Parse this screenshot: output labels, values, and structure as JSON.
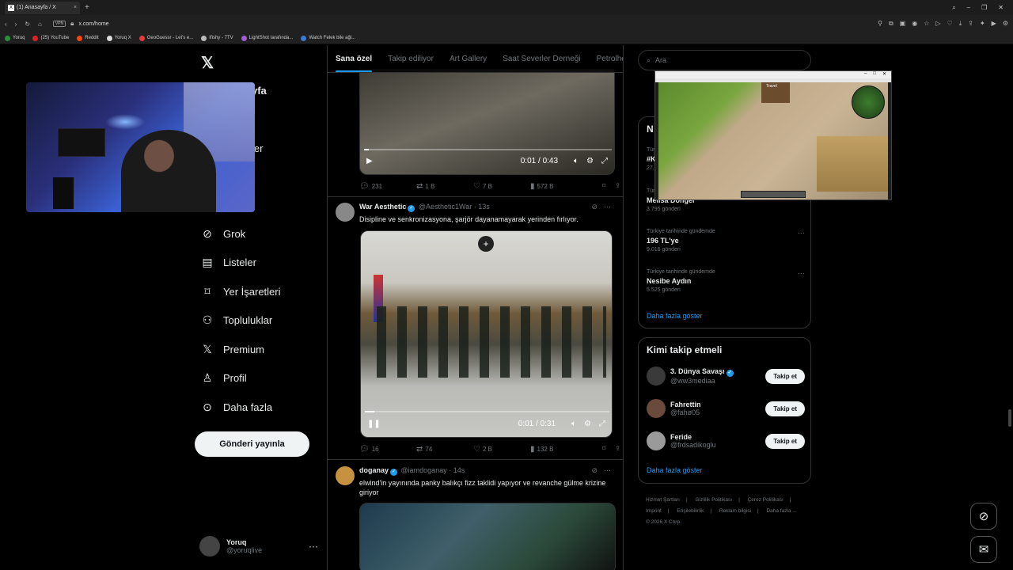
{
  "browser": {
    "tab_title": "(1) Anasayfa / X",
    "url": "x.com/home",
    "vpn_label": "VPN",
    "bookmarks": [
      "Yoruq",
      "(25) YouTube",
      "Reddit",
      "Yoruq X",
      "GeoGuessr - Let's e...",
      "Ifishy - 7TV",
      "LightShot tarafında...",
      "Watch Felek bile ağl..."
    ]
  },
  "leftnav": {
    "partials": [
      "yfa",
      "ler",
      "t",
      "t"
    ],
    "items": [
      {
        "label": "Grok",
        "icon": "grok-icon"
      },
      {
        "label": "Listeler",
        "icon": "list-icon"
      },
      {
        "label": "Yer İşaretleri",
        "icon": "bookmark-icon"
      },
      {
        "label": "Topluluklar",
        "icon": "communities-icon"
      },
      {
        "label": "Premium",
        "icon": "x-premium-icon"
      },
      {
        "label": "Profil",
        "icon": "profile-icon"
      },
      {
        "label": "Daha fazla",
        "icon": "more-circle-icon"
      }
    ],
    "post_button": "Gönderi yayınla",
    "profile": {
      "name": "Yoruq",
      "handle": "@yoruqlive"
    }
  },
  "timeline": {
    "tabs": [
      "Sana özel",
      "Takip ediliyor",
      "Art Gallery",
      "Saat Severler Derneği",
      "Petrolhe"
    ],
    "video1": {
      "time": "0:01 / 0:43",
      "progress": 0.02
    },
    "tweet1_stats": {
      "replies": "231",
      "retweets": "1 B",
      "likes": "7 B",
      "views": "572 B"
    },
    "tweet2": {
      "name": "War Aesthetic",
      "handle": "@Aesthetic1War · 13s",
      "text": "Disipline ve senkronizasyona, şarjör dayanamayarak yerinden fırlıyor.",
      "video_time": "0:01 / 0:31",
      "progress": 0.04,
      "stats": {
        "replies": "16",
        "retweets": "74",
        "likes": "2 B",
        "views": "132 B"
      }
    },
    "tweet3": {
      "name": "doganay",
      "handle": "@iamdoganay · 14s",
      "text": "elwind'in yayınında panky balıkçı fizz taklidi yapıyor ve revanche gülme krizine giriyor"
    }
  },
  "right": {
    "search_placeholder": "Ara",
    "trends_partial_title": "N",
    "trends": [
      {
        "context": "Tür",
        "name": "#K",
        "count": "27."
      },
      {
        "context": "Tür",
        "name": "Melisa Döngel",
        "count": "3.795 gönderi"
      },
      {
        "context": "Türkiye tarihinde gündemde",
        "name": "196 TL'ye",
        "count": "9.016 gönderi"
      },
      {
        "context": "Türkiye tarihinde gündemde",
        "name": "Nesibe Aydın",
        "count": "5.525 gönderi"
      }
    ],
    "show_more": "Daha fazla göster",
    "follow_title": "Kimi takip etmeli",
    "follow": [
      {
        "name": "3. Dünya Savaşı",
        "handle": "@ww3mediaa",
        "verified": true
      },
      {
        "name": "Fahrettin",
        "handle": "@fahø05",
        "verified": false
      },
      {
        "name": "Feride",
        "handle": "@frdsadikoglu",
        "verified": false
      }
    ],
    "follow_button": "Takip et",
    "footer_links": [
      "Hizmet Şartları",
      "|",
      "Gizlilik Politikası",
      "|",
      "Çerez Politikası",
      "|",
      "Imprint",
      "|",
      "Erişilebilirlik",
      "|",
      "Reklam bilgisi",
      "|",
      "Daha fazla ...",
      "© 2026 X Corp."
    ]
  },
  "game_overlay": {
    "door_label": "Travel"
  }
}
